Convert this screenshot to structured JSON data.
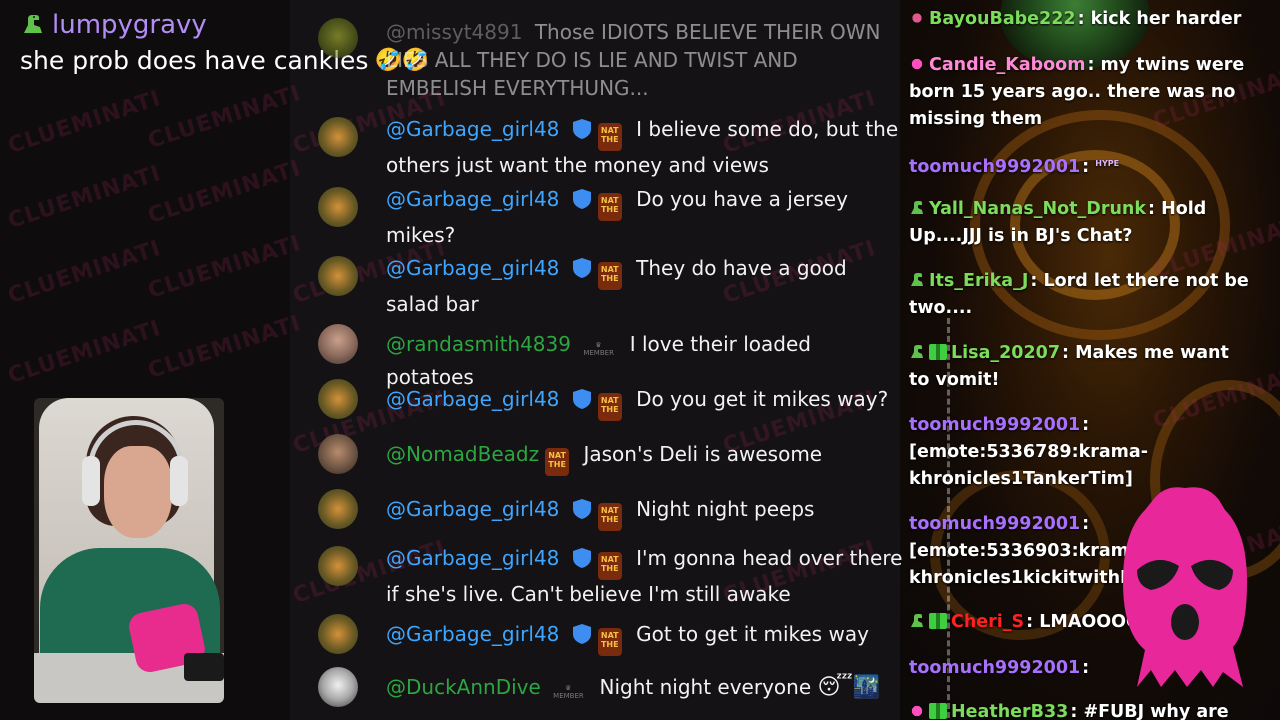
{
  "top_message": {
    "username": "lumpygravy",
    "text": "she prob does have cankles",
    "emojis": "🤣🤣",
    "name_color": "#b28ef4"
  },
  "watermark": {
    "text_a": "CLUE",
    "text_b": "MINATI"
  },
  "youtube_chat": {
    "messages": [
      {
        "author": "@missyt4891",
        "text": "Those IDIOTS BELIEVE THEIR OWN LIES ALL THEY DO IS LIE AND TWIST AND EMBELISH EVERYTHUNG...",
        "style": "faded"
      },
      {
        "author": "@Garbage_girl48",
        "text": "I believe some do, but the others just want the money and views",
        "badges": "shield-nat"
      },
      {
        "author": "@Garbage_girl48",
        "text": "Do you have a jersey mikes?",
        "badges": "shield-nat"
      },
      {
        "author": "@Garbage_girl48",
        "text": "They do have a good salad bar",
        "badges": "shield-nat"
      },
      {
        "author": "@randasmith4839",
        "text": "I love their loaded potatoes",
        "badges": "crown"
      },
      {
        "author": "@Garbage_girl48",
        "text": "Do you get it mikes way?",
        "badges": "shield-nat"
      },
      {
        "author": "@NomadBeadz",
        "text": "Jason's Deli is awesome",
        "badges": "nat"
      },
      {
        "author": "@Garbage_girl48",
        "text": "Night night peeps",
        "badges": "shield-nat"
      },
      {
        "author": "@Garbage_girl48",
        "text": "I'm gonna head over there if she's live. Can't believe I'm still awake",
        "badges": "shield-nat"
      },
      {
        "author": "@Garbage_girl48",
        "text": "Got to get it mikes way",
        "badges": "shield-nat"
      },
      {
        "author": "@DuckAnnDive",
        "text": "Night night everyone",
        "emojis": "😴🌃",
        "badges": "crown"
      }
    ],
    "badge_nat_text": "NAT\nTHE",
    "badge_crown_text": "MEMBER",
    "colors": {
      "author_blue": "#3ea6ff",
      "author_green": "#2ba640"
    }
  },
  "twitch_chat": {
    "messages": [
      {
        "name": "BayouBabe222",
        "text": "kick her harder",
        "color": "#7ddc5c"
      },
      {
        "name": "Candie_Kaboom",
        "text": "my twins were born 15 years ago.. there was no missing them",
        "color": "#ff8ad8"
      },
      {
        "name": "toomuch9992001",
        "text": "",
        "emote": "HYPE",
        "color": "#a970ff"
      },
      {
        "name": "Yall_Nanas_Not_Drunk",
        "text": "Hold Up....JJJ is in BJ's Chat?",
        "color": "#7ddc5c"
      },
      {
        "name": "Its_Erika_J",
        "text": "Lord let there not be two....",
        "color": "#7ddc5c"
      },
      {
        "name": "Lisa_20207",
        "text": "Makes me want to vomit!",
        "color": "#7ddc5c"
      },
      {
        "name": "toomuch9992001",
        "text": "[emote:5336789:krama-khronicles1TankerTim]",
        "color": "#a970ff"
      },
      {
        "name": "toomuch9992001",
        "text": "[emote:5336903:krama-khronicles1kickitwithK",
        "color": "#a970ff"
      },
      {
        "name": "Cheri_S",
        "text": "LMAOOOO",
        "color": "#ff2020"
      },
      {
        "name": "toomuch9992001",
        "text": "",
        "color": "#a970ff"
      },
      {
        "name": "HeatherB33",
        "text": "#FUBJ why are you",
        "color": "#7ddc5c"
      }
    ]
  }
}
